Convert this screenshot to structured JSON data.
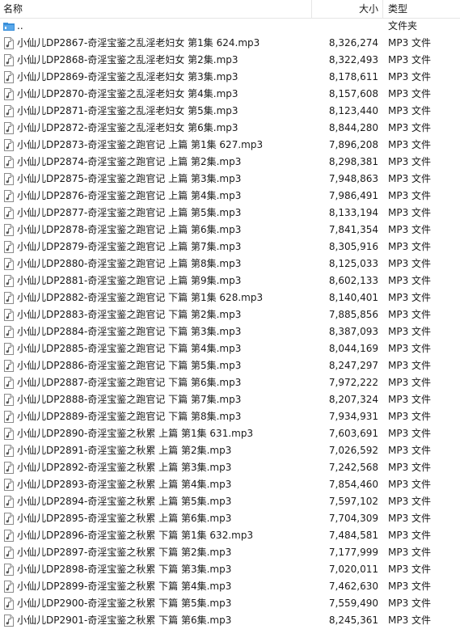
{
  "header": {
    "name_label": "名称",
    "size_label": "大小",
    "type_label": "类型",
    "sort_indicator": "^"
  },
  "parent_row": {
    "name": "..",
    "type": "文件夹",
    "icon": "folder-up-icon"
  },
  "files": [
    {
      "name": "小仙儿DP2867-奇淫宝鉴之乱淫老妇女 第1集 624.mp3",
      "size": "8,326,274",
      "type": "MP3 文件"
    },
    {
      "name": "小仙儿DP2868-奇淫宝鉴之乱淫老妇女 第2集.mp3",
      "size": "8,322,493",
      "type": "MP3 文件"
    },
    {
      "name": "小仙儿DP2869-奇淫宝鉴之乱淫老妇女 第3集.mp3",
      "size": "8,178,611",
      "type": "MP3 文件"
    },
    {
      "name": "小仙儿DP2870-奇淫宝鉴之乱淫老妇女 第4集.mp3",
      "size": "8,157,608",
      "type": "MP3 文件"
    },
    {
      "name": "小仙儿DP2871-奇淫宝鉴之乱淫老妇女 第5集.mp3",
      "size": "8,123,440",
      "type": "MP3 文件"
    },
    {
      "name": "小仙儿DP2872-奇淫宝鉴之乱淫老妇女 第6集.mp3",
      "size": "8,844,280",
      "type": "MP3 文件"
    },
    {
      "name": "小仙儿DP2873-奇淫宝鉴之跑官记 上篇 第1集 627.mp3",
      "size": "7,896,208",
      "type": "MP3 文件"
    },
    {
      "name": "小仙儿DP2874-奇淫宝鉴之跑官记 上篇 第2集.mp3",
      "size": "8,298,381",
      "type": "MP3 文件"
    },
    {
      "name": "小仙儿DP2875-奇淫宝鉴之跑官记 上篇 第3集.mp3",
      "size": "7,948,863",
      "type": "MP3 文件"
    },
    {
      "name": "小仙儿DP2876-奇淫宝鉴之跑官记 上篇 第4集.mp3",
      "size": "7,986,491",
      "type": "MP3 文件"
    },
    {
      "name": "小仙儿DP2877-奇淫宝鉴之跑官记 上篇 第5集.mp3",
      "size": "8,133,194",
      "type": "MP3 文件"
    },
    {
      "name": "小仙儿DP2878-奇淫宝鉴之跑官记 上篇 第6集.mp3",
      "size": "7,841,354",
      "type": "MP3 文件"
    },
    {
      "name": "小仙儿DP2879-奇淫宝鉴之跑官记 上篇 第7集.mp3",
      "size": "8,305,916",
      "type": "MP3 文件"
    },
    {
      "name": "小仙儿DP2880-奇淫宝鉴之跑官记 上篇 第8集.mp3",
      "size": "8,125,033",
      "type": "MP3 文件"
    },
    {
      "name": "小仙儿DP2881-奇淫宝鉴之跑官记 上篇 第9集.mp3",
      "size": "8,602,133",
      "type": "MP3 文件"
    },
    {
      "name": "小仙儿DP2882-奇淫宝鉴之跑官记 下篇 第1集 628.mp3",
      "size": "8,140,401",
      "type": "MP3 文件"
    },
    {
      "name": "小仙儿DP2883-奇淫宝鉴之跑官记 下篇 第2集.mp3",
      "size": "7,885,856",
      "type": "MP3 文件"
    },
    {
      "name": "小仙儿DP2884-奇淫宝鉴之跑官记 下篇 第3集.mp3",
      "size": "8,387,093",
      "type": "MP3 文件"
    },
    {
      "name": "小仙儿DP2885-奇淫宝鉴之跑官记 下篇 第4集.mp3",
      "size": "8,044,169",
      "type": "MP3 文件"
    },
    {
      "name": "小仙儿DP2886-奇淫宝鉴之跑官记 下篇 第5集.mp3",
      "size": "8,247,297",
      "type": "MP3 文件"
    },
    {
      "name": "小仙儿DP2887-奇淫宝鉴之跑官记 下篇 第6集.mp3",
      "size": "7,972,222",
      "type": "MP3 文件"
    },
    {
      "name": "小仙儿DP2888-奇淫宝鉴之跑官记 下篇 第7集.mp3",
      "size": "8,207,324",
      "type": "MP3 文件"
    },
    {
      "name": "小仙儿DP2889-奇淫宝鉴之跑官记 下篇 第8集.mp3",
      "size": "7,934,931",
      "type": "MP3 文件"
    },
    {
      "name": "小仙儿DP2890-奇淫宝鉴之秋累 上篇 第1集 631.mp3",
      "size": "7,603,691",
      "type": "MP3 文件"
    },
    {
      "name": "小仙儿DP2891-奇淫宝鉴之秋累 上篇 第2集.mp3",
      "size": "7,026,592",
      "type": "MP3 文件"
    },
    {
      "name": "小仙儿DP2892-奇淫宝鉴之秋累 上篇 第3集.mp3",
      "size": "7,242,568",
      "type": "MP3 文件"
    },
    {
      "name": "小仙儿DP2893-奇淫宝鉴之秋累 上篇 第4集.mp3",
      "size": "7,854,460",
      "type": "MP3 文件"
    },
    {
      "name": "小仙儿DP2894-奇淫宝鉴之秋累 上篇 第5集.mp3",
      "size": "7,597,102",
      "type": "MP3 文件"
    },
    {
      "name": "小仙儿DP2895-奇淫宝鉴之秋累 上篇 第6集.mp3",
      "size": "7,704,309",
      "type": "MP3 文件"
    },
    {
      "name": "小仙儿DP2896-奇淫宝鉴之秋累 下篇 第1集 632.mp3",
      "size": "7,484,581",
      "type": "MP3 文件"
    },
    {
      "name": "小仙儿DP2897-奇淫宝鉴之秋累 下篇 第2集.mp3",
      "size": "7,177,999",
      "type": "MP3 文件"
    },
    {
      "name": "小仙儿DP2898-奇淫宝鉴之秋累 下篇 第3集.mp3",
      "size": "7,020,011",
      "type": "MP3 文件"
    },
    {
      "name": "小仙儿DP2899-奇淫宝鉴之秋累 下篇 第4集.mp3",
      "size": "7,462,630",
      "type": "MP3 文件"
    },
    {
      "name": "小仙儿DP2900-奇淫宝鉴之秋累 下篇 第5集.mp3",
      "size": "7,559,490",
      "type": "MP3 文件"
    },
    {
      "name": "小仙儿DP2901-奇淫宝鉴之秋累 下篇 第6集.mp3",
      "size": "8,245,361",
      "type": "MP3 文件"
    }
  ],
  "file_icon": "audio-file-icon",
  "colors": {
    "folder": "#3a8fd9",
    "header_divider": "#e5e5e5",
    "text": "#1a1a1a"
  }
}
